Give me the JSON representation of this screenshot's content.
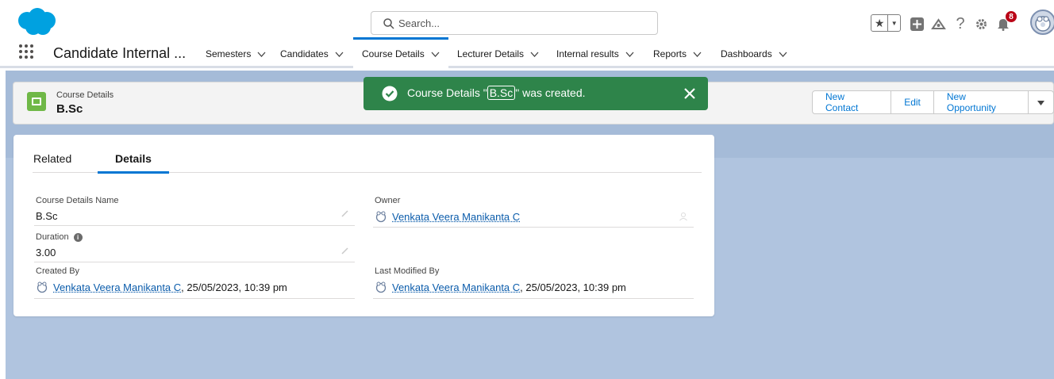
{
  "header": {
    "search_placeholder": "Search...",
    "notification_count": "8",
    "icons": [
      "salesforce-logo",
      "star-icon",
      "chevron-down-icon",
      "add-icon",
      "trailhead-icon",
      "help-icon",
      "gear-icon",
      "bell-icon",
      "avatar"
    ]
  },
  "nav": {
    "app_name": "Candidate Internal ...",
    "tabs": [
      {
        "label": "Semesters",
        "active": false
      },
      {
        "label": "Candidates",
        "active": false
      },
      {
        "label": "Course Details",
        "active": true
      },
      {
        "label": "Lecturer Details",
        "active": false
      },
      {
        "label": "Internal results",
        "active": false
      },
      {
        "label": "Reports",
        "active": false
      },
      {
        "label": "Dashboards",
        "active": false
      }
    ]
  },
  "record": {
    "object_type": "Course Details",
    "title": "B.Sc"
  },
  "actions": {
    "new_contact": "New Contact",
    "edit": "Edit",
    "new_opportunity": "New Opportunity"
  },
  "toast": {
    "prefix": "Course Details \"",
    "record": "B.Sc",
    "suffix": "\" was created."
  },
  "detail_tabs": [
    "Related",
    "Details"
  ],
  "fields": {
    "name": {
      "label": "Course Details Name",
      "value": "B.Sc"
    },
    "owner": {
      "label": "Owner",
      "value": "Venkata Veera Manikanta C"
    },
    "duration": {
      "label": "Duration",
      "value": "3.00"
    },
    "created_by": {
      "label": "Created By",
      "user": "Venkata Veera Manikanta C",
      "date": ", 25/05/2023, 10:39 pm"
    },
    "last_modified_by": {
      "label": "Last Modified By",
      "user": "Venkata Veera Manikanta C",
      "date": ", 25/05/2023, 10:39 pm"
    }
  },
  "colors": {
    "brand": "#0176d3",
    "toast_success": "#2e844a",
    "object_icon": "#6fb847",
    "background": "#b0c4df"
  }
}
